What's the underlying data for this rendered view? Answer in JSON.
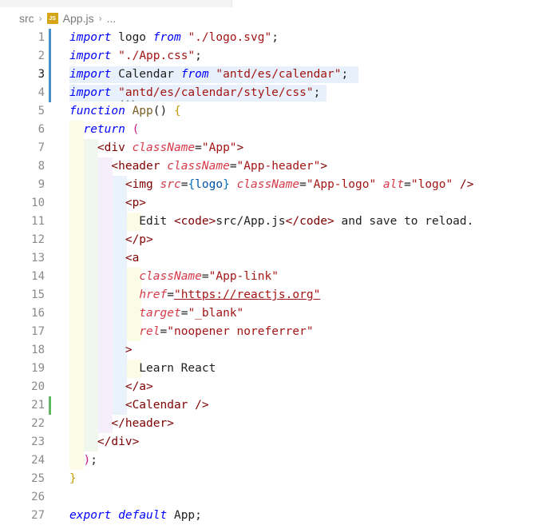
{
  "breadcrumb": {
    "folder": "src",
    "file": "App.js",
    "more": "...",
    "file_icon_label": "JS"
  },
  "lines": [
    {
      "n": "1"
    },
    {
      "n": "2"
    },
    {
      "n": "3"
    },
    {
      "n": "4"
    },
    {
      "n": "5"
    },
    {
      "n": "6"
    },
    {
      "n": "7"
    },
    {
      "n": "8"
    },
    {
      "n": "9"
    },
    {
      "n": "10"
    },
    {
      "n": "11"
    },
    {
      "n": "12"
    },
    {
      "n": "13"
    },
    {
      "n": "14"
    },
    {
      "n": "15"
    },
    {
      "n": "16"
    },
    {
      "n": "17"
    },
    {
      "n": "18"
    },
    {
      "n": "19"
    },
    {
      "n": "20"
    },
    {
      "n": "21"
    },
    {
      "n": "22"
    },
    {
      "n": "23"
    },
    {
      "n": "24"
    },
    {
      "n": "25"
    },
    {
      "n": "26"
    },
    {
      "n": "27"
    }
  ],
  "active_line": "3",
  "code": [
    [
      [
        "kw",
        "import"
      ],
      [
        "punc",
        " logo "
      ],
      [
        "kw",
        "from"
      ],
      [
        "punc",
        " "
      ],
      [
        "str",
        "\"./logo.svg\""
      ],
      [
        "punc",
        ";"
      ]
    ],
    [
      [
        "kw",
        "import"
      ],
      [
        "punc",
        " "
      ],
      [
        "str",
        "\"./App.css\""
      ],
      [
        "punc",
        ";"
      ]
    ],
    [
      [
        "kw",
        "import"
      ],
      [
        "punc",
        " Calendar "
      ],
      [
        "kw",
        "from"
      ],
      [
        "punc",
        " "
      ],
      [
        "str",
        "\"antd/es/calendar\""
      ],
      [
        "punc",
        ";"
      ]
    ],
    [
      [
        "kw",
        "import"
      ],
      [
        "punc",
        " "
      ],
      [
        "str",
        "\"antd/es/calendar/style/css\""
      ],
      [
        "punc",
        ";"
      ]
    ],
    [
      [
        "kw",
        "function"
      ],
      [
        "punc",
        " "
      ],
      [
        "fn",
        "App"
      ],
      [
        "punc",
        "() "
      ],
      [
        "brace",
        "{"
      ]
    ],
    [
      [
        "punc",
        "  "
      ],
      [
        "kw",
        "return"
      ],
      [
        "punc",
        " "
      ],
      [
        "brace2",
        "("
      ]
    ],
    [
      [
        "punc",
        "    "
      ],
      [
        "tag",
        "<div"
      ],
      [
        "punc",
        " "
      ],
      [
        "attrn",
        "className"
      ],
      [
        "punc",
        "="
      ],
      [
        "str",
        "\"App\""
      ],
      [
        "tag",
        ">"
      ]
    ],
    [
      [
        "punc",
        "      "
      ],
      [
        "tag",
        "<header"
      ],
      [
        "punc",
        " "
      ],
      [
        "attrn",
        "className"
      ],
      [
        "punc",
        "="
      ],
      [
        "str",
        "\"App-header\""
      ],
      [
        "tag",
        ">"
      ]
    ],
    [
      [
        "punc",
        "        "
      ],
      [
        "tag",
        "<img"
      ],
      [
        "punc",
        " "
      ],
      [
        "attrn",
        "src"
      ],
      [
        "punc",
        "="
      ],
      [
        "jsx",
        "{"
      ],
      [
        "val",
        "logo"
      ],
      [
        "jsx",
        "}"
      ],
      [
        "punc",
        " "
      ],
      [
        "attrn",
        "className"
      ],
      [
        "punc",
        "="
      ],
      [
        "str",
        "\"App-logo\""
      ],
      [
        "punc",
        " "
      ],
      [
        "attrn",
        "alt"
      ],
      [
        "punc",
        "="
      ],
      [
        "str",
        "\"logo\""
      ],
      [
        "punc",
        " "
      ],
      [
        "tag",
        "/>"
      ]
    ],
    [
      [
        "punc",
        "        "
      ],
      [
        "tag",
        "<p>"
      ]
    ],
    [
      [
        "punc",
        "          Edit "
      ],
      [
        "tag",
        "<code>"
      ],
      [
        "punc",
        "src/App.js"
      ],
      [
        "tag",
        "</code>"
      ],
      [
        "punc",
        " and save to reload."
      ]
    ],
    [
      [
        "punc",
        "        "
      ],
      [
        "tag",
        "</p>"
      ]
    ],
    [
      [
        "punc",
        "        "
      ],
      [
        "tag",
        "<a"
      ]
    ],
    [
      [
        "punc",
        "          "
      ],
      [
        "attrn",
        "className"
      ],
      [
        "punc",
        "="
      ],
      [
        "str",
        "\"App-link\""
      ]
    ],
    [
      [
        "punc",
        "          "
      ],
      [
        "attrn",
        "href"
      ],
      [
        "punc",
        "="
      ],
      [
        "link",
        "\"https://reactjs.org\""
      ]
    ],
    [
      [
        "punc",
        "          "
      ],
      [
        "attrn",
        "target"
      ],
      [
        "punc",
        "="
      ],
      [
        "str",
        "\"_blank\""
      ]
    ],
    [
      [
        "punc",
        "          "
      ],
      [
        "attrn",
        "rel"
      ],
      [
        "punc",
        "="
      ],
      [
        "str",
        "\"noopener noreferrer\""
      ]
    ],
    [
      [
        "punc",
        "        "
      ],
      [
        "tag",
        ">"
      ]
    ],
    [
      [
        "punc",
        "          Learn React"
      ]
    ],
    [
      [
        "punc",
        "        "
      ],
      [
        "tag",
        "</a>"
      ]
    ],
    [
      [
        "punc",
        "        "
      ],
      [
        "tag",
        "<Calendar"
      ],
      [
        "punc",
        " "
      ],
      [
        "tag",
        "/>"
      ]
    ],
    [
      [
        "punc",
        "      "
      ],
      [
        "tag",
        "</header>"
      ]
    ],
    [
      [
        "punc",
        "    "
      ],
      [
        "tag",
        "</div>"
      ]
    ],
    [
      [
        "punc",
        "  "
      ],
      [
        "brace2",
        ")"
      ],
      [
        "punc",
        ";"
      ]
    ],
    [
      [
        "brace",
        "}"
      ]
    ],
    [],
    [
      [
        "kw",
        "export"
      ],
      [
        "punc",
        " "
      ],
      [
        "kw",
        "default"
      ],
      [
        "punc",
        " App;"
      ]
    ]
  ],
  "colors": {
    "keyword": "#0000ff",
    "string": "#a31515",
    "tag": "#800000",
    "gutter_modified": "#4a90c8",
    "gutter_added": "#5fb761"
  }
}
